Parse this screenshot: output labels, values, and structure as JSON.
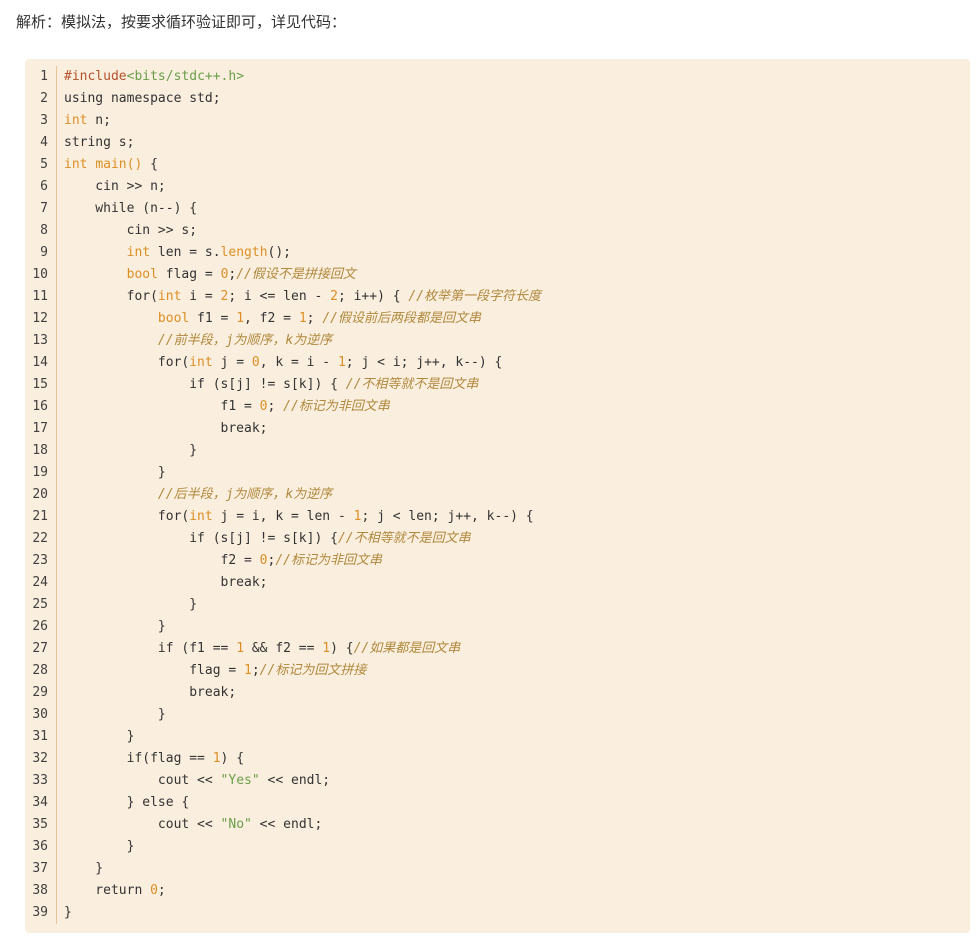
{
  "intro": "解析：模拟法，按要求循环验证即可，详见代码：",
  "code": {
    "lines": [
      {
        "no": "1",
        "tokens": [
          {
            "t": "#include",
            "c": "pp"
          },
          {
            "t": "<bits/stdc++.h>",
            "c": "str"
          }
        ]
      },
      {
        "no": "2",
        "tokens": [
          {
            "t": "using namespace std;",
            "c": ""
          }
        ]
      },
      {
        "no": "3",
        "tokens": [
          {
            "t": "int",
            "c": "kw"
          },
          {
            "t": " n;",
            "c": ""
          }
        ]
      },
      {
        "no": "4",
        "tokens": [
          {
            "t": "string s;",
            "c": ""
          }
        ]
      },
      {
        "no": "5",
        "tokens": [
          {
            "t": "int",
            "c": "kw"
          },
          {
            "t": " ",
            "c": ""
          },
          {
            "t": "main()",
            "c": "kw"
          },
          {
            "t": " {",
            "c": ""
          }
        ]
      },
      {
        "no": "6",
        "tokens": [
          {
            "t": "    cin >> n;",
            "c": ""
          }
        ]
      },
      {
        "no": "7",
        "tokens": [
          {
            "t": "    while (n--) {",
            "c": ""
          }
        ]
      },
      {
        "no": "8",
        "tokens": [
          {
            "t": "        cin >> s;",
            "c": ""
          }
        ]
      },
      {
        "no": "9",
        "tokens": [
          {
            "t": "        ",
            "c": ""
          },
          {
            "t": "int",
            "c": "kw"
          },
          {
            "t": " len = s.",
            "c": ""
          },
          {
            "t": "length",
            "c": "kw"
          },
          {
            "t": "();",
            "c": ""
          }
        ]
      },
      {
        "no": "10",
        "tokens": [
          {
            "t": "        ",
            "c": ""
          },
          {
            "t": "bool",
            "c": "kw"
          },
          {
            "t": " flag = ",
            "c": ""
          },
          {
            "t": "0",
            "c": "kw"
          },
          {
            "t": ";",
            "c": ""
          },
          {
            "t": "//假设不是拼接回文",
            "c": "cm"
          }
        ]
      },
      {
        "no": "11",
        "tokens": [
          {
            "t": "        for(",
            "c": ""
          },
          {
            "t": "int",
            "c": "kw"
          },
          {
            "t": " i = ",
            "c": ""
          },
          {
            "t": "2",
            "c": "kw"
          },
          {
            "t": "; i <= len - ",
            "c": ""
          },
          {
            "t": "2",
            "c": "kw"
          },
          {
            "t": "; i++) { ",
            "c": ""
          },
          {
            "t": "//枚举第一段字符长度",
            "c": "cm"
          }
        ]
      },
      {
        "no": "12",
        "tokens": [
          {
            "t": "            ",
            "c": ""
          },
          {
            "t": "bool",
            "c": "kw"
          },
          {
            "t": " f1 = ",
            "c": ""
          },
          {
            "t": "1",
            "c": "kw"
          },
          {
            "t": ", f2 = ",
            "c": ""
          },
          {
            "t": "1",
            "c": "kw"
          },
          {
            "t": "; ",
            "c": ""
          },
          {
            "t": "//假设前后两段都是回文串",
            "c": "cm"
          }
        ]
      },
      {
        "no": "13",
        "tokens": [
          {
            "t": "            ",
            "c": ""
          },
          {
            "t": "//前半段，j为顺序，k为逆序",
            "c": "cm"
          }
        ]
      },
      {
        "no": "14",
        "tokens": [
          {
            "t": "            for(",
            "c": ""
          },
          {
            "t": "int",
            "c": "kw"
          },
          {
            "t": " j = ",
            "c": ""
          },
          {
            "t": "0",
            "c": "kw"
          },
          {
            "t": ", k = i - ",
            "c": ""
          },
          {
            "t": "1",
            "c": "kw"
          },
          {
            "t": "; j < i; j++, k--) {",
            "c": ""
          }
        ]
      },
      {
        "no": "15",
        "tokens": [
          {
            "t": "                if (s[j] != s[k]) { ",
            "c": ""
          },
          {
            "t": "//不相等就不是回文串",
            "c": "cm"
          }
        ]
      },
      {
        "no": "16",
        "tokens": [
          {
            "t": "                    f1 = ",
            "c": ""
          },
          {
            "t": "0",
            "c": "kw"
          },
          {
            "t": "; ",
            "c": ""
          },
          {
            "t": "//标记为非回文串",
            "c": "cm"
          }
        ]
      },
      {
        "no": "17",
        "tokens": [
          {
            "t": "                    break;",
            "c": ""
          }
        ]
      },
      {
        "no": "18",
        "tokens": [
          {
            "t": "                }",
            "c": ""
          }
        ]
      },
      {
        "no": "19",
        "tokens": [
          {
            "t": "            }",
            "c": ""
          }
        ]
      },
      {
        "no": "20",
        "tokens": [
          {
            "t": "            ",
            "c": ""
          },
          {
            "t": "//后半段，j为顺序，k为逆序",
            "c": "cm"
          }
        ]
      },
      {
        "no": "21",
        "tokens": [
          {
            "t": "            for(",
            "c": ""
          },
          {
            "t": "int",
            "c": "kw"
          },
          {
            "t": " j = i, k = len - ",
            "c": ""
          },
          {
            "t": "1",
            "c": "kw"
          },
          {
            "t": "; j < len; j++, k--) {",
            "c": ""
          }
        ]
      },
      {
        "no": "22",
        "tokens": [
          {
            "t": "                if (s[j] != s[k]) {",
            "c": ""
          },
          {
            "t": "//不相等就不是回文串",
            "c": "cm"
          }
        ]
      },
      {
        "no": "23",
        "tokens": [
          {
            "t": "                    f2 = ",
            "c": ""
          },
          {
            "t": "0",
            "c": "kw"
          },
          {
            "t": ";",
            "c": ""
          },
          {
            "t": "//标记为非回文串",
            "c": "cm"
          }
        ]
      },
      {
        "no": "24",
        "tokens": [
          {
            "t": "                    break;",
            "c": ""
          }
        ]
      },
      {
        "no": "25",
        "tokens": [
          {
            "t": "                }",
            "c": ""
          }
        ]
      },
      {
        "no": "26",
        "tokens": [
          {
            "t": "            }",
            "c": ""
          }
        ]
      },
      {
        "no": "27",
        "tokens": [
          {
            "t": "            if (f1 == ",
            "c": ""
          },
          {
            "t": "1",
            "c": "kw"
          },
          {
            "t": " && f2 == ",
            "c": ""
          },
          {
            "t": "1",
            "c": "kw"
          },
          {
            "t": ") {",
            "c": ""
          },
          {
            "t": "//如果都是回文串",
            "c": "cm"
          }
        ]
      },
      {
        "no": "28",
        "tokens": [
          {
            "t": "                flag = ",
            "c": ""
          },
          {
            "t": "1",
            "c": "kw"
          },
          {
            "t": ";",
            "c": ""
          },
          {
            "t": "//标记为回文拼接",
            "c": "cm"
          }
        ]
      },
      {
        "no": "29",
        "tokens": [
          {
            "t": "                break;",
            "c": ""
          }
        ]
      },
      {
        "no": "30",
        "tokens": [
          {
            "t": "            }",
            "c": ""
          }
        ]
      },
      {
        "no": "31",
        "tokens": [
          {
            "t": "        }",
            "c": ""
          }
        ]
      },
      {
        "no": "32",
        "tokens": [
          {
            "t": "        if(flag == ",
            "c": ""
          },
          {
            "t": "1",
            "c": "kw"
          },
          {
            "t": ") {",
            "c": ""
          }
        ]
      },
      {
        "no": "33",
        "tokens": [
          {
            "t": "            cout << ",
            "c": ""
          },
          {
            "t": "\"Yes\"",
            "c": "str"
          },
          {
            "t": " << endl;",
            "c": ""
          }
        ]
      },
      {
        "no": "34",
        "tokens": [
          {
            "t": "        } else {",
            "c": ""
          }
        ]
      },
      {
        "no": "35",
        "tokens": [
          {
            "t": "            cout << ",
            "c": ""
          },
          {
            "t": "\"No\"",
            "c": "str"
          },
          {
            "t": " << endl;",
            "c": ""
          }
        ]
      },
      {
        "no": "36",
        "tokens": [
          {
            "t": "        }",
            "c": ""
          }
        ]
      },
      {
        "no": "37",
        "tokens": [
          {
            "t": "    }",
            "c": ""
          }
        ]
      },
      {
        "no": "38",
        "tokens": [
          {
            "t": "    return ",
            "c": ""
          },
          {
            "t": "0",
            "c": "kw"
          },
          {
            "t": ";",
            "c": ""
          }
        ]
      },
      {
        "no": "39",
        "tokens": [
          {
            "t": "}",
            "c": ""
          }
        ]
      }
    ]
  }
}
